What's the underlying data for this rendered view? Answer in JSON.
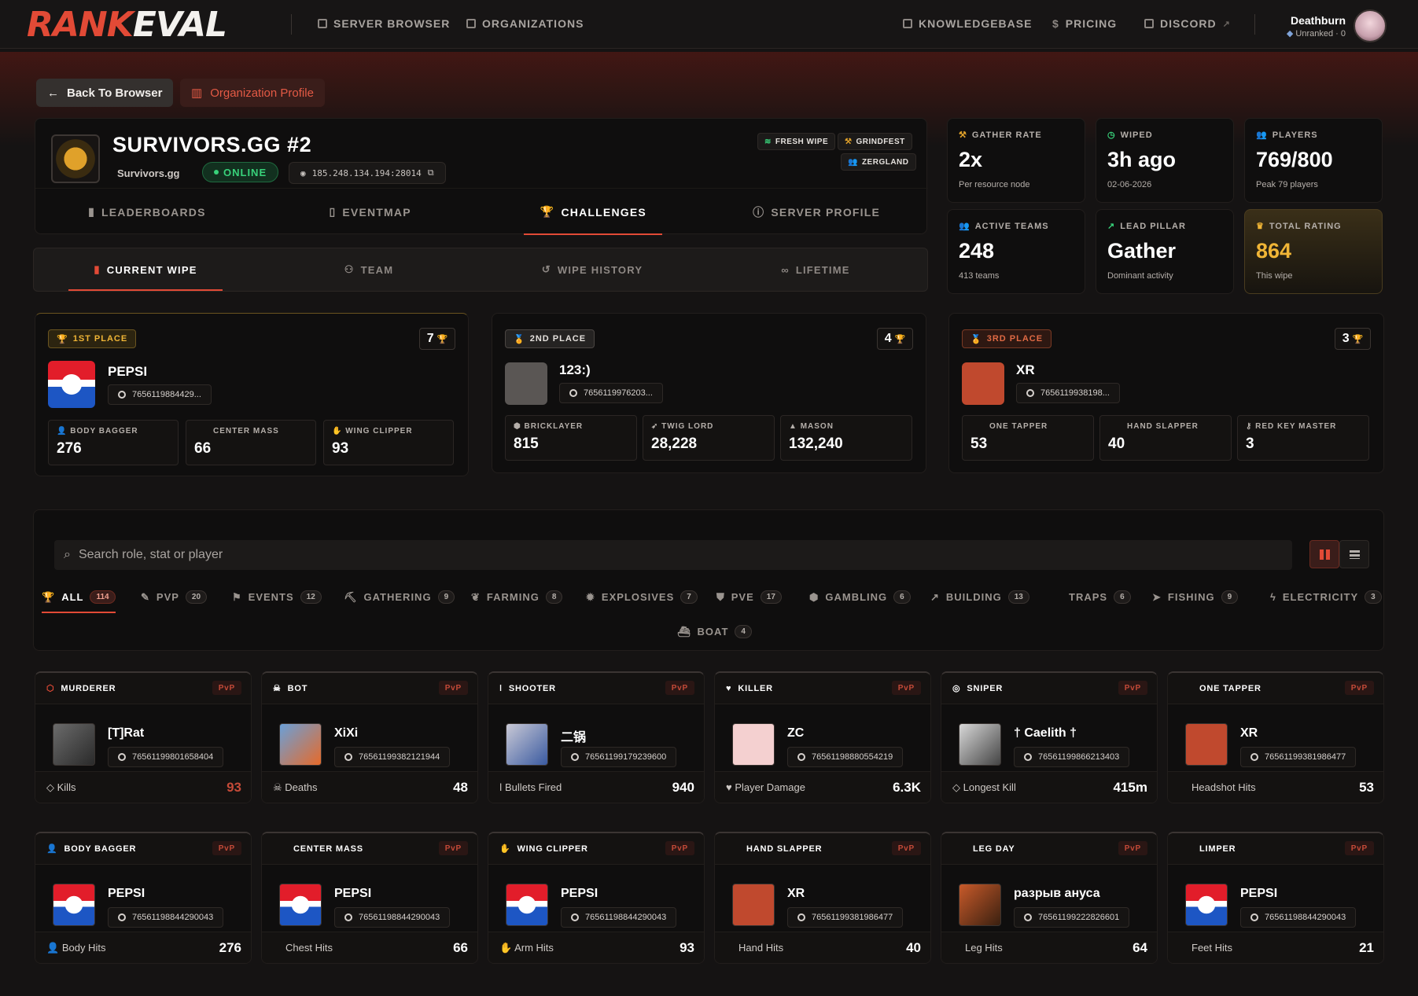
{
  "nav": {
    "logo_red": "RANK",
    "logo_white": "EVAL",
    "links": [
      "SERVER BROWSER",
      "ORGANIZATIONS",
      "KNOWLEDGEBASE",
      "PRICING",
      "DISCORD"
    ],
    "user_name": "Deathburn",
    "user_rank": "Unranked · 0"
  },
  "actions": {
    "back": "Back To Browser",
    "org": "Organization Profile"
  },
  "server": {
    "title": "SURVIVORS.GG #2",
    "org": "Survivors.gg",
    "status": "ONLINE",
    "ip": "185.248.134.194:28014",
    "tags": [
      "FRESH WIPE",
      "GRINDFEST",
      "ZERGLAND"
    ],
    "tabs": [
      "LEADERBOARDS",
      "EVENTMAP",
      "CHALLENGES",
      "SERVER PROFILE"
    ],
    "active_tab": "CHALLENGES"
  },
  "subtabs": [
    "CURRENT WIPE",
    "TEAM",
    "WIPE HISTORY",
    "LIFETIME"
  ],
  "stats": [
    {
      "label": "GATHER RATE",
      "value": "2x",
      "sub": "Per resource node"
    },
    {
      "label": "WIPED",
      "value": "3h ago",
      "sub": "02-06-2026"
    },
    {
      "label": "PLAYERS",
      "value": "769/800",
      "sub": "Peak 79 players"
    },
    {
      "label": "ACTIVE TEAMS",
      "value": "248",
      "sub": "413 teams"
    },
    {
      "label": "LEAD PILLAR",
      "value": "Gather",
      "sub": "Dominant activity"
    },
    {
      "label": "TOTAL RATING",
      "value": "864",
      "sub": "This wipe"
    }
  ],
  "podium": [
    {
      "place": "1ST PLACE",
      "count": "7",
      "name": "PEPSI",
      "steam": "7656119884429...",
      "metrics": [
        {
          "label": "BODY BAGGER",
          "value": "276"
        },
        {
          "label": "CENTER MASS",
          "value": "66"
        },
        {
          "label": "WING CLIPPER",
          "value": "93"
        }
      ]
    },
    {
      "place": "2ND PLACE",
      "count": "4",
      "name": "123:)",
      "steam": "7656119976203...",
      "metrics": [
        {
          "label": "BRICKLAYER",
          "value": "815"
        },
        {
          "label": "TWIG LORD",
          "value": "28,228"
        },
        {
          "label": "MASON",
          "value": "132,240"
        }
      ]
    },
    {
      "place": "3RD PLACE",
      "count": "3",
      "name": "XR",
      "steam": "7656119938198...",
      "metrics": [
        {
          "label": "ONE TAPPER",
          "value": "53"
        },
        {
          "label": "HAND SLAPPER",
          "value": "40"
        },
        {
          "label": "RED KEY MASTER",
          "value": "3"
        }
      ]
    }
  ],
  "search": {
    "placeholder": "Search role, stat or player"
  },
  "filters": [
    {
      "label": "ALL",
      "count": "114"
    },
    {
      "label": "PVP",
      "count": "20"
    },
    {
      "label": "EVENTS",
      "count": "12"
    },
    {
      "label": "GATHERING",
      "count": "9"
    },
    {
      "label": "FARMING",
      "count": "8"
    },
    {
      "label": "EXPLOSIVES",
      "count": "7"
    },
    {
      "label": "PVE",
      "count": "17"
    },
    {
      "label": "GAMBLING",
      "count": "6"
    },
    {
      "label": "BUILDING",
      "count": "13"
    },
    {
      "label": "TRAPS",
      "count": "6"
    },
    {
      "label": "FISHING",
      "count": "9"
    },
    {
      "label": "ELECTRICITY",
      "count": "3"
    },
    {
      "label": "BOAT",
      "count": "4"
    }
  ],
  "roles": [
    {
      "role": "MURDERER",
      "tag": "PvP",
      "name": "[T]Rat",
      "steam": "76561199801658404",
      "stat": "Kills",
      "value": "93"
    },
    {
      "role": "BOT",
      "tag": "PvP",
      "name": "XiXi",
      "steam": "76561199382121944",
      "stat": "Deaths",
      "value": "48"
    },
    {
      "role": "SHOOTER",
      "tag": "PvP",
      "name": "二锅",
      "steam": "76561199179239600",
      "stat": "Bullets Fired",
      "value": "940"
    },
    {
      "role": "KILLER",
      "tag": "PvP",
      "name": "ZC",
      "steam": "76561198880554219",
      "stat": "Player Damage",
      "value": "6.3K"
    },
    {
      "role": "SNIPER",
      "tag": "PvP",
      "name": "† Caelith †",
      "steam": "76561199866213403",
      "stat": "Longest Kill",
      "value": "415m"
    },
    {
      "role": "ONE TAPPER",
      "tag": "PvP",
      "name": "XR",
      "steam": "76561199381986477",
      "stat": "Headshot Hits",
      "value": "53"
    },
    {
      "role": "BODY BAGGER",
      "tag": "PvP",
      "name": "PEPSI",
      "steam": "76561198844290043",
      "stat": "Body Hits",
      "value": "276"
    },
    {
      "role": "CENTER MASS",
      "tag": "PvP",
      "name": "PEPSI",
      "steam": "76561198844290043",
      "stat": "Chest Hits",
      "value": "66"
    },
    {
      "role": "WING CLIPPER",
      "tag": "PvP",
      "name": "PEPSI",
      "steam": "76561198844290043",
      "stat": "Arm Hits",
      "value": "93"
    },
    {
      "role": "HAND SLAPPER",
      "tag": "PvP",
      "name": "XR",
      "steam": "76561199381986477",
      "stat": "Hand Hits",
      "value": "40"
    },
    {
      "role": "LEG DAY",
      "tag": "PvP",
      "name": "разрыв ануса",
      "steam": "76561199222826601",
      "stat": "Leg Hits",
      "value": "64"
    },
    {
      "role": "LIMPER",
      "tag": "PvP",
      "name": "PEPSI",
      "steam": "76561198844290043",
      "stat": "Feet Hits",
      "value": "21"
    }
  ]
}
